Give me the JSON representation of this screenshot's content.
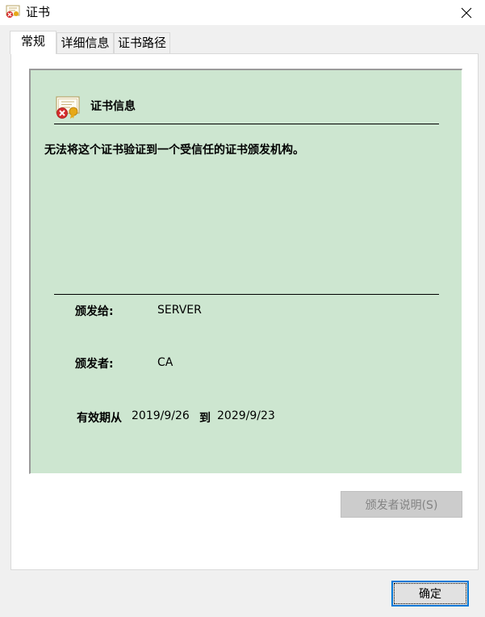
{
  "window": {
    "title": "证书",
    "icon": "certificate-error-icon",
    "close_icon": "close-icon"
  },
  "tabs": [
    {
      "label": "常规",
      "active": true
    },
    {
      "label": "详细信息",
      "active": false
    },
    {
      "label": "证书路径",
      "active": false
    }
  ],
  "general": {
    "info_title": "证书信息",
    "info_icon": "certificate-error-icon",
    "warning": "无法将这个证书验证到一个受信任的证书颁发机构。",
    "issued_to_label": "颁发给:",
    "issued_to_value": "SERVER",
    "issued_by_label": "颁发者:",
    "issued_by_value": "CA",
    "validity_label": "有效期从",
    "valid_from": "2019/9/26",
    "to_label": "到",
    "valid_to": "2029/9/23",
    "issuer_statement_button": "颁发者说明(S)",
    "issuer_statement_enabled": false
  },
  "footer": {
    "ok_label": "确定"
  },
  "colors": {
    "info_background": "#cde6d0",
    "focus_border": "#0078d7"
  }
}
